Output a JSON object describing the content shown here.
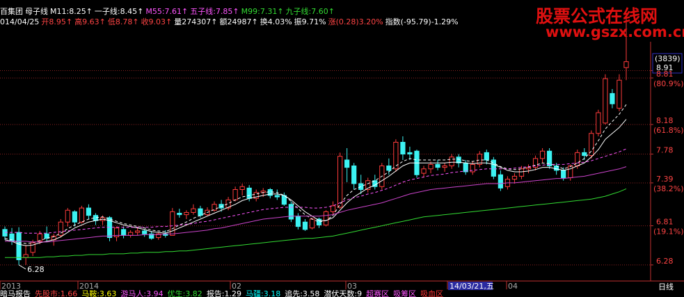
{
  "header": {
    "row1": [
      {
        "text": "百集团",
        "color": "#ffffff"
      },
      {
        "text": "母子线",
        "color": "#ffffff"
      },
      {
        "text": "M11:8.25↑",
        "color": "#ffffff"
      },
      {
        "text": "一子线:8.45↑",
        "color": "#ffffff"
      },
      {
        "text": "M55:7.61↑",
        "color": "#ff55ff"
      },
      {
        "text": "五子线:7.85↑",
        "color": "#ff55ff"
      },
      {
        "text": "M99:7.31↑",
        "color": "#33dd33"
      },
      {
        "text": "九子线:7.60↑",
        "color": "#33dd33"
      }
    ],
    "row2": [
      {
        "text": "014/04/25",
        "color": "#ffffff"
      },
      {
        "text": "开8.95↑",
        "color": "#ff4444"
      },
      {
        "text": "高9.63↑",
        "color": "#ff4444"
      },
      {
        "text": "低8.78↑",
        "color": "#ff4444"
      },
      {
        "text": "收9.03↑",
        "color": "#ff4444"
      },
      {
        "text": "量274307↑",
        "color": "#ffffff"
      },
      {
        "text": "额24987↑",
        "color": "#ffffff"
      },
      {
        "text": "换4.03%",
        "color": "#ffffff"
      },
      {
        "text": "振9.71%",
        "color": "#ffffff"
      },
      {
        "text": "涨(0.28)3.20%",
        "color": "#ff4444"
      },
      {
        "text": "指数(-95.79)-1.29%",
        "color": "#ffffff"
      }
    ]
  },
  "watermark": {
    "line1": "股票公式在线网",
    "line2": "www.gszx.com.cn"
  },
  "chart_data": {
    "type": "candlestick",
    "price_axis": {
      "ticks": [
        "8.91",
        "8.81",
        "8.18",
        "7.78",
        "7.39",
        "6.81",
        "6.28"
      ],
      "percent_labels": [
        "(80.9%)",
        "(61.8%)",
        "(38.2%)",
        "(19.1%)"
      ],
      "top_label": "(3839)",
      "range": [
        6.1,
        9.3
      ]
    },
    "low_annotation": "6.28",
    "x_labels": [
      "2013",
      "2014",
      "02",
      "03",
      "14/03/21,五",
      "04"
    ],
    "period_label": "日线",
    "candles": [
      {
        "o": 6.76,
        "h": 6.8,
        "l": 6.62,
        "c": 6.67
      },
      {
        "o": 6.7,
        "h": 6.78,
        "l": 6.55,
        "c": 6.6
      },
      {
        "o": 6.72,
        "h": 6.79,
        "l": 6.28,
        "c": 6.35
      },
      {
        "o": 6.38,
        "h": 6.55,
        "l": 6.28,
        "c": 6.42
      },
      {
        "o": 6.45,
        "h": 6.62,
        "l": 6.4,
        "c": 6.58
      },
      {
        "o": 6.6,
        "h": 6.74,
        "l": 6.56,
        "c": 6.7
      },
      {
        "o": 6.7,
        "h": 6.8,
        "l": 6.6,
        "c": 6.64
      },
      {
        "o": 6.62,
        "h": 6.7,
        "l": 6.54,
        "c": 6.67
      },
      {
        "o": 6.68,
        "h": 6.9,
        "l": 6.65,
        "c": 6.86
      },
      {
        "o": 6.86,
        "h": 7.05,
        "l": 6.8,
        "c": 7.02
      },
      {
        "o": 7.0,
        "h": 7.02,
        "l": 6.8,
        "c": 6.86
      },
      {
        "o": 6.86,
        "h": 7.08,
        "l": 6.84,
        "c": 7.05
      },
      {
        "o": 7.05,
        "h": 7.1,
        "l": 6.9,
        "c": 6.95
      },
      {
        "o": 6.95,
        "h": 6.98,
        "l": 6.82,
        "c": 6.88
      },
      {
        "o": 6.88,
        "h": 6.95,
        "l": 6.82,
        "c": 6.92
      },
      {
        "o": 6.92,
        "h": 6.94,
        "l": 6.6,
        "c": 6.65
      },
      {
        "o": 6.66,
        "h": 6.8,
        "l": 6.6,
        "c": 6.78
      },
      {
        "o": 6.76,
        "h": 6.8,
        "l": 6.64,
        "c": 6.68
      },
      {
        "o": 6.68,
        "h": 6.75,
        "l": 6.65,
        "c": 6.72
      },
      {
        "o": 6.72,
        "h": 6.78,
        "l": 6.68,
        "c": 6.74
      },
      {
        "o": 6.74,
        "h": 6.76,
        "l": 6.66,
        "c": 6.7
      },
      {
        "o": 6.7,
        "h": 6.74,
        "l": 6.62,
        "c": 6.64
      },
      {
        "o": 6.65,
        "h": 6.72,
        "l": 6.62,
        "c": 6.7
      },
      {
        "o": 6.7,
        "h": 6.75,
        "l": 6.65,
        "c": 6.68
      },
      {
        "o": 6.68,
        "h": 7.05,
        "l": 6.68,
        "c": 7.0
      },
      {
        "o": 6.98,
        "h": 7.04,
        "l": 6.92,
        "c": 6.96
      },
      {
        "o": 6.96,
        "h": 7.02,
        "l": 6.9,
        "c": 6.99
      },
      {
        "o": 6.99,
        "h": 7.1,
        "l": 6.96,
        "c": 7.04
      },
      {
        "o": 7.04,
        "h": 7.08,
        "l": 6.92,
        "c": 6.95
      },
      {
        "o": 6.96,
        "h": 7.06,
        "l": 6.94,
        "c": 7.02
      },
      {
        "o": 7.02,
        "h": 7.14,
        "l": 7.0,
        "c": 7.1
      },
      {
        "o": 7.1,
        "h": 7.16,
        "l": 7.0,
        "c": 7.05
      },
      {
        "o": 7.05,
        "h": 7.2,
        "l": 7.02,
        "c": 7.16
      },
      {
        "o": 7.16,
        "h": 7.34,
        "l": 7.14,
        "c": 7.3
      },
      {
        "o": 7.3,
        "h": 7.38,
        "l": 7.22,
        "c": 7.34
      },
      {
        "o": 7.32,
        "h": 7.36,
        "l": 7.14,
        "c": 7.18
      },
      {
        "o": 7.18,
        "h": 7.3,
        "l": 7.14,
        "c": 7.26
      },
      {
        "o": 7.26,
        "h": 7.32,
        "l": 7.2,
        "c": 7.28
      },
      {
        "o": 7.3,
        "h": 7.32,
        "l": 7.18,
        "c": 7.22
      },
      {
        "o": 7.22,
        "h": 7.3,
        "l": 7.16,
        "c": 7.2
      },
      {
        "o": 7.22,
        "h": 7.26,
        "l": 7.08,
        "c": 7.1
      },
      {
        "o": 7.1,
        "h": 7.14,
        "l": 6.86,
        "c": 6.9
      },
      {
        "o": 6.94,
        "h": 6.98,
        "l": 6.76,
        "c": 6.8
      },
      {
        "o": 6.86,
        "h": 6.9,
        "l": 6.74,
        "c": 6.76
      },
      {
        "o": 6.78,
        "h": 6.92,
        "l": 6.76,
        "c": 6.9
      },
      {
        "o": 6.9,
        "h": 6.92,
        "l": 6.78,
        "c": 6.82
      },
      {
        "o": 6.82,
        "h": 7.02,
        "l": 6.8,
        "c": 7.0
      },
      {
        "o": 7.0,
        "h": 7.14,
        "l": 6.96,
        "c": 7.08
      },
      {
        "o": 7.06,
        "h": 7.8,
        "l": 7.04,
        "c": 7.75
      },
      {
        "o": 7.7,
        "h": 7.86,
        "l": 7.4,
        "c": 7.6
      },
      {
        "o": 7.62,
        "h": 7.66,
        "l": 7.3,
        "c": 7.38
      },
      {
        "o": 7.38,
        "h": 7.5,
        "l": 7.24,
        "c": 7.3
      },
      {
        "o": 7.3,
        "h": 7.46,
        "l": 7.26,
        "c": 7.42
      },
      {
        "o": 7.42,
        "h": 7.5,
        "l": 7.3,
        "c": 7.34
      },
      {
        "o": 7.34,
        "h": 7.66,
        "l": 7.3,
        "c": 7.62
      },
      {
        "o": 7.62,
        "h": 7.72,
        "l": 7.5,
        "c": 7.56
      },
      {
        "o": 7.58,
        "h": 7.98,
        "l": 7.54,
        "c": 7.94
      },
      {
        "o": 7.94,
        "h": 8.02,
        "l": 7.7,
        "c": 7.78
      },
      {
        "o": 7.8,
        "h": 7.88,
        "l": 7.7,
        "c": 7.78
      },
      {
        "o": 7.82,
        "h": 7.84,
        "l": 7.46,
        "c": 7.5
      },
      {
        "o": 7.52,
        "h": 7.62,
        "l": 7.46,
        "c": 7.58
      },
      {
        "o": 7.58,
        "h": 7.68,
        "l": 7.52,
        "c": 7.64
      },
      {
        "o": 7.64,
        "h": 7.7,
        "l": 7.56,
        "c": 7.6
      },
      {
        "o": 7.6,
        "h": 7.66,
        "l": 7.54,
        "c": 7.62
      },
      {
        "o": 7.62,
        "h": 7.78,
        "l": 7.58,
        "c": 7.74
      },
      {
        "o": 7.74,
        "h": 7.78,
        "l": 7.6,
        "c": 7.66
      },
      {
        "o": 7.66,
        "h": 7.7,
        "l": 7.5,
        "c": 7.54
      },
      {
        "o": 7.54,
        "h": 7.68,
        "l": 7.5,
        "c": 7.64
      },
      {
        "o": 7.64,
        "h": 7.82,
        "l": 7.6,
        "c": 7.78
      },
      {
        "o": 7.8,
        "h": 7.84,
        "l": 7.64,
        "c": 7.7
      },
      {
        "o": 7.7,
        "h": 7.74,
        "l": 7.44,
        "c": 7.48
      },
      {
        "o": 7.5,
        "h": 7.56,
        "l": 7.28,
        "c": 7.32
      },
      {
        "o": 7.34,
        "h": 7.48,
        "l": 7.3,
        "c": 7.44
      },
      {
        "o": 7.44,
        "h": 7.52,
        "l": 7.38,
        "c": 7.48
      },
      {
        "o": 7.48,
        "h": 7.62,
        "l": 7.44,
        "c": 7.58
      },
      {
        "o": 7.58,
        "h": 7.64,
        "l": 7.52,
        "c": 7.6
      },
      {
        "o": 7.6,
        "h": 7.76,
        "l": 7.56,
        "c": 7.72
      },
      {
        "o": 7.72,
        "h": 7.86,
        "l": 7.66,
        "c": 7.82
      },
      {
        "o": 7.82,
        "h": 7.86,
        "l": 7.58,
        "c": 7.62
      },
      {
        "o": 7.62,
        "h": 7.66,
        "l": 7.5,
        "c": 7.56
      },
      {
        "o": 7.56,
        "h": 7.6,
        "l": 7.42,
        "c": 7.46
      },
      {
        "o": 7.46,
        "h": 7.64,
        "l": 7.42,
        "c": 7.62
      },
      {
        "o": 7.62,
        "h": 7.84,
        "l": 7.58,
        "c": 7.8
      },
      {
        "o": 7.8,
        "h": 7.86,
        "l": 7.7,
        "c": 7.76
      },
      {
        "o": 7.76,
        "h": 8.1,
        "l": 7.72,
        "c": 8.06
      },
      {
        "o": 8.06,
        "h": 8.38,
        "l": 8.02,
        "c": 8.34
      },
      {
        "o": 8.2,
        "h": 8.86,
        "l": 8.18,
        "c": 8.8
      },
      {
        "o": 8.6,
        "h": 8.66,
        "l": 8.4,
        "c": 8.46
      },
      {
        "o": 8.4,
        "h": 8.86,
        "l": 8.36,
        "c": 8.78
      },
      {
        "o": 8.95,
        "h": 9.63,
        "l": 8.78,
        "c": 9.03
      }
    ],
    "indicators": [
      {
        "name": "M11",
        "value": "8.25",
        "color": "#ffffff",
        "dash": false,
        "values": [
          6.62,
          6.6,
          6.56,
          6.54,
          6.55,
          6.58,
          6.6,
          6.62,
          6.66,
          6.72,
          6.78,
          6.82,
          6.86,
          6.88,
          6.9,
          6.88,
          6.85,
          6.82,
          6.8,
          6.78,
          6.76,
          6.73,
          6.72,
          6.71,
          6.74,
          6.78,
          6.82,
          6.86,
          6.9,
          6.94,
          6.98,
          7.02,
          7.06,
          7.1,
          7.15,
          7.18,
          7.2,
          7.22,
          7.24,
          7.24,
          7.22,
          7.16,
          7.08,
          7.0,
          6.94,
          6.88,
          6.88,
          6.92,
          7.02,
          7.12,
          7.2,
          7.26,
          7.32,
          7.36,
          7.42,
          7.48,
          7.55,
          7.62,
          7.66,
          7.66,
          7.66,
          7.66,
          7.66,
          7.66,
          7.67,
          7.67,
          7.66,
          7.65,
          7.66,
          7.66,
          7.64,
          7.6,
          7.56,
          7.54,
          7.54,
          7.55,
          7.57,
          7.6,
          7.6,
          7.58,
          7.56,
          7.58,
          7.62,
          7.66,
          7.74,
          7.84,
          7.98,
          8.06,
          8.14,
          8.25
        ]
      },
      {
        "name": "一子线",
        "value": "8.45",
        "color": "#ffffff",
        "dash": true,
        "values": [
          6.64,
          6.62,
          6.58,
          6.57,
          6.58,
          6.61,
          6.64,
          6.66,
          6.71,
          6.77,
          6.82,
          6.86,
          6.9,
          6.92,
          6.93,
          6.9,
          6.87,
          6.84,
          6.82,
          6.8,
          6.78,
          6.75,
          6.74,
          6.73,
          6.77,
          6.82,
          6.86,
          6.91,
          6.95,
          6.99,
          7.03,
          7.07,
          7.11,
          7.16,
          7.2,
          7.22,
          7.24,
          7.26,
          7.27,
          7.26,
          7.22,
          7.14,
          7.04,
          6.96,
          6.9,
          6.86,
          6.88,
          6.95,
          7.1,
          7.22,
          7.3,
          7.34,
          7.38,
          7.42,
          7.48,
          7.54,
          7.62,
          7.68,
          7.72,
          7.7,
          7.7,
          7.7,
          7.7,
          7.7,
          7.71,
          7.71,
          7.69,
          7.68,
          7.7,
          7.7,
          7.66,
          7.61,
          7.58,
          7.57,
          7.58,
          7.6,
          7.63,
          7.66,
          7.65,
          7.62,
          7.58,
          7.61,
          7.66,
          7.72,
          7.82,
          7.96,
          8.12,
          8.22,
          8.32,
          8.45
        ]
      },
      {
        "name": "M55",
        "value": "7.61",
        "color": "#cc44cc",
        "dash": false,
        "values": [
          6.6,
          6.6,
          6.6,
          6.6,
          6.59,
          6.59,
          6.59,
          6.6,
          6.61,
          6.62,
          6.63,
          6.64,
          6.65,
          6.66,
          6.67,
          6.67,
          6.68,
          6.68,
          6.68,
          6.68,
          6.69,
          6.69,
          6.69,
          6.7,
          6.7,
          6.71,
          6.72,
          6.73,
          6.74,
          6.75,
          6.77,
          6.78,
          6.8,
          6.82,
          6.84,
          6.86,
          6.88,
          6.9,
          6.91,
          6.92,
          6.93,
          6.94,
          6.94,
          6.94,
          6.94,
          6.94,
          6.95,
          6.96,
          6.99,
          7.02,
          7.04,
          7.06,
          7.08,
          7.1,
          7.12,
          7.15,
          7.18,
          7.21,
          7.24,
          7.26,
          7.28,
          7.3,
          7.31,
          7.32,
          7.33,
          7.34,
          7.35,
          7.36,
          7.37,
          7.38,
          7.38,
          7.38,
          7.39,
          7.39,
          7.4,
          7.41,
          7.42,
          7.43,
          7.44,
          7.45,
          7.45,
          7.46,
          7.47,
          7.48,
          7.5,
          7.52,
          7.54,
          7.56,
          7.58,
          7.61
        ]
      },
      {
        "name": "五子线",
        "value": "7.85",
        "color": "#ff55ff",
        "dash": true,
        "values": [
          6.72,
          6.72,
          6.72,
          6.71,
          6.71,
          6.71,
          6.71,
          6.72,
          6.73,
          6.74,
          6.75,
          6.76,
          6.77,
          6.78,
          6.79,
          6.79,
          6.79,
          6.79,
          6.79,
          6.79,
          6.79,
          6.79,
          6.8,
          6.8,
          6.81,
          6.82,
          6.83,
          6.84,
          6.86,
          6.87,
          6.89,
          6.91,
          6.93,
          6.95,
          6.97,
          6.99,
          7.01,
          7.03,
          7.04,
          7.05,
          7.06,
          7.06,
          7.06,
          7.06,
          7.05,
          7.05,
          7.06,
          7.08,
          7.12,
          7.16,
          7.19,
          7.21,
          7.24,
          7.26,
          7.29,
          7.32,
          7.36,
          7.4,
          7.43,
          7.45,
          7.47,
          7.49,
          7.5,
          7.51,
          7.53,
          7.54,
          7.55,
          7.56,
          7.57,
          7.58,
          7.58,
          7.58,
          7.58,
          7.59,
          7.6,
          7.61,
          7.62,
          7.63,
          7.64,
          7.64,
          7.64,
          7.65,
          7.66,
          7.67,
          7.69,
          7.72,
          7.75,
          7.78,
          7.81,
          7.85
        ]
      },
      {
        "name": "M99",
        "value": "7.31",
        "color": "#33dd33",
        "dash": false,
        "values": [
          6.38,
          6.38,
          6.38,
          6.38,
          6.38,
          6.38,
          6.39,
          6.39,
          6.4,
          6.4,
          6.41,
          6.41,
          6.42,
          6.42,
          6.42,
          6.43,
          6.43,
          6.43,
          6.44,
          6.44,
          6.45,
          6.45,
          6.45,
          6.46,
          6.46,
          6.47,
          6.47,
          6.48,
          6.49,
          6.5,
          6.51,
          6.52,
          6.53,
          6.54,
          6.55,
          6.56,
          6.57,
          6.58,
          6.59,
          6.6,
          6.61,
          6.62,
          6.63,
          6.64,
          6.64,
          6.65,
          6.66,
          6.67,
          6.69,
          6.71,
          6.73,
          6.75,
          6.77,
          6.79,
          6.81,
          6.83,
          6.85,
          6.87,
          6.89,
          6.91,
          6.93,
          6.94,
          6.95,
          6.96,
          6.97,
          6.98,
          6.99,
          7.0,
          7.01,
          7.02,
          7.03,
          7.04,
          7.05,
          7.06,
          7.07,
          7.08,
          7.09,
          7.1,
          7.11,
          7.12,
          7.13,
          7.14,
          7.15,
          7.16,
          7.17,
          7.19,
          7.21,
          7.24,
          7.27,
          7.31
        ]
      }
    ]
  },
  "bottom_bar": [
    {
      "text": "暗马报告",
      "color": "#ffffff"
    },
    {
      "text": "先股市:1.66",
      "color": "#ff4444"
    },
    {
      "text": "马鞍:3.63",
      "color": "#ffff00"
    },
    {
      "text": "游马人:3.94",
      "color": "#ff55ff"
    },
    {
      "text": "优生:3.82",
      "color": "#33dd33"
    },
    {
      "text": "报告:1.29",
      "color": "#ffffff"
    },
    {
      "text": "马疆:3.18",
      "color": "#00ffff"
    },
    {
      "text": "追先:3.58",
      "color": "#ffffff"
    },
    {
      "text": "潜伏天数:9",
      "color": "#ffffff"
    },
    {
      "text": "超赛区",
      "color": "#ff55ff"
    },
    {
      "text": "吸筹区",
      "color": "#ff55ff"
    },
    {
      "text": "吸血区",
      "color": "#ff3333"
    }
  ]
}
